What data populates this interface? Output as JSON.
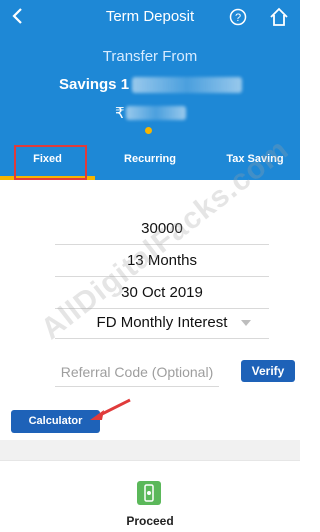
{
  "header": {
    "title": "Term Deposit",
    "back_icon": "arrow-back-icon",
    "help_icon": "help-icon",
    "home_icon": "home-icon"
  },
  "account": {
    "section_label": "Transfer From",
    "account_name": "Savings 1",
    "currency_symbol": "₹"
  },
  "tabs": [
    {
      "label": "Fixed",
      "active": true
    },
    {
      "label": "Recurring",
      "active": false
    },
    {
      "label": "Tax Saving",
      "active": false
    }
  ],
  "form": {
    "amount": "30000",
    "tenure": "13 Months",
    "date": "30 Oct 2019",
    "interest_option": "FD Monthly Interest",
    "referral_placeholder": "Referral Code (Optional)",
    "verify_label": "Verify"
  },
  "calculator_label": "Calculator",
  "footer": {
    "proceed_label": "Proceed",
    "proceed_icon": "phone-icon"
  },
  "watermark": "AllDigitalFacks.com",
  "colors": {
    "primary": "#1e88d6",
    "accent": "#f7b500",
    "button": "#1e62b8",
    "highlight": "#e03b3b",
    "proceed": "#5bb85a"
  }
}
